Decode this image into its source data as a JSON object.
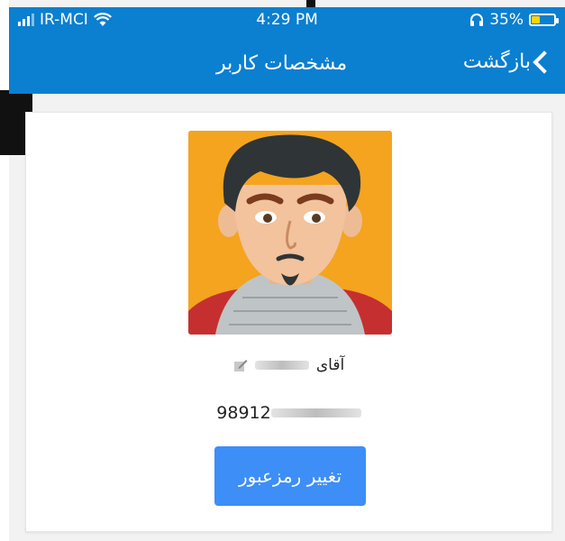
{
  "status_bar": {
    "carrier": "IR-MCI",
    "time": "4:29 PM",
    "battery_percent": "35%"
  },
  "nav": {
    "title": "مشخصات کاربر",
    "back_label": "بازگشت"
  },
  "profile": {
    "name_prefix": "آقای",
    "phone_prefix": "98912",
    "change_password_label": "تغییر رمزعبور"
  },
  "colors": {
    "brand_blue": "#0b7fd0",
    "button_blue": "#3d8ef7",
    "avatar_bg": "#f4a41f",
    "battery_fill": "#ffd500"
  },
  "icons": {
    "signal": "signal-icon",
    "wifi": "wifi-icon",
    "headphones": "headphones-icon",
    "battery": "battery-icon",
    "back": "chevron-left-icon",
    "edit": "edit-icon"
  }
}
